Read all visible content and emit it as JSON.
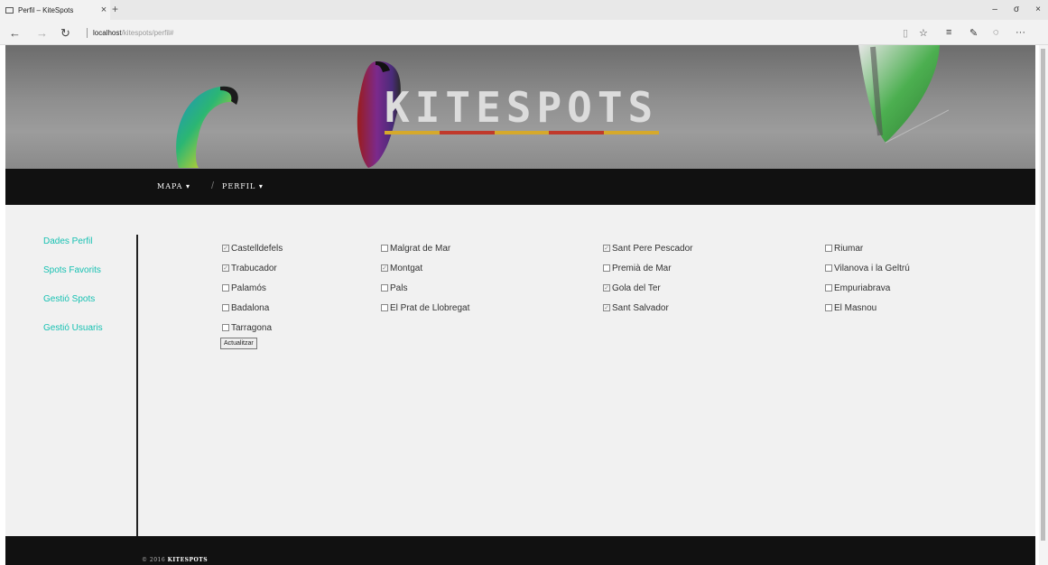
{
  "browser": {
    "tab_title": "Perfil – KiteSpots",
    "tab_close": "×",
    "new_tab": "+",
    "url_host": "localhost",
    "url_path": "/kitespots/perfil#",
    "win_min": "–",
    "win_max": "σ",
    "win_close": "×"
  },
  "site": {
    "logo": "KITESPOTS",
    "logo_colors": [
      "#d6a92b",
      "#c0392b",
      "#d6a92b",
      "#c0392b",
      "#d6a92b"
    ]
  },
  "nav": {
    "mapa": "MAPA ▾",
    "sep": "/",
    "perfil": "PERFIL ▾"
  },
  "sidebar": {
    "items": [
      "Dades Perfil",
      "Spots Favorits",
      "Gestió Spots",
      "Gestió Usuaris"
    ]
  },
  "spots": {
    "columns": [
      [
        {
          "name": "Castelldefels",
          "checked": true
        },
        {
          "name": "Trabucador",
          "checked": true
        },
        {
          "name": "Palamós",
          "checked": false
        },
        {
          "name": "Badalona",
          "checked": false
        },
        {
          "name": "Tarragona",
          "checked": false
        }
      ],
      [
        {
          "name": "Malgrat de Mar",
          "checked": false
        },
        {
          "name": "Montgat",
          "checked": true
        },
        {
          "name": "Pals",
          "checked": false
        },
        {
          "name": "El Prat de Llobregat",
          "checked": false
        }
      ],
      [
        {
          "name": "Sant Pere Pescador",
          "checked": true
        },
        {
          "name": "Premià de Mar",
          "checked": false
        },
        {
          "name": "Gola del Ter",
          "checked": true
        },
        {
          "name": "Sant Salvador",
          "checked": true
        }
      ],
      [
        {
          "name": "Riumar",
          "checked": false
        },
        {
          "name": "Vilanova i la Geltrú",
          "checked": false
        },
        {
          "name": "Empuriabrava",
          "checked": false
        },
        {
          "name": "El Masnou",
          "checked": false
        }
      ]
    ],
    "update_label": "Actualitzar"
  },
  "footer": {
    "copyright": "© 2016",
    "brand": "KITESPOTS"
  },
  "colors": {
    "accent": "#17c1b2",
    "dark": "#111111",
    "content_bg": "#f1f1f1"
  }
}
